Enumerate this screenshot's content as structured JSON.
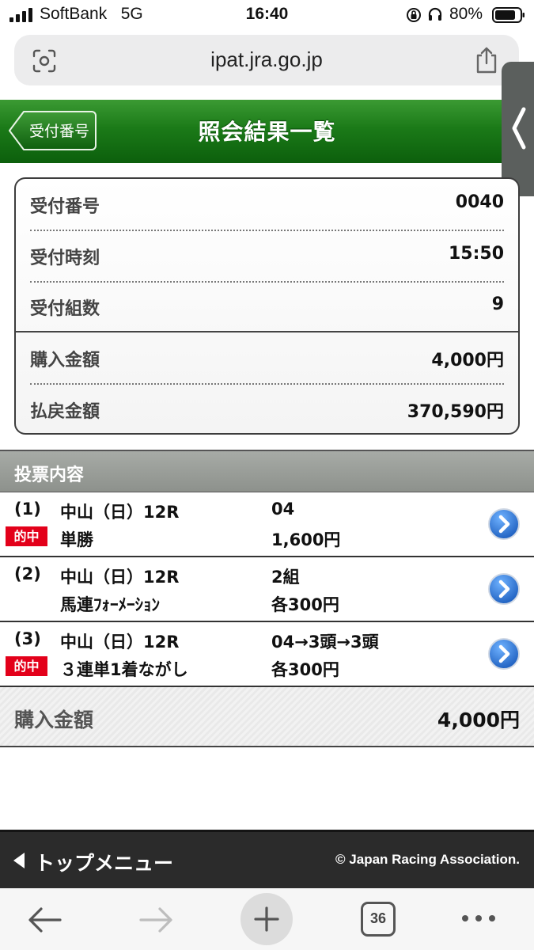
{
  "status_bar": {
    "carrier": "SoftBank",
    "network": "5G",
    "time": "16:40",
    "battery": "80%"
  },
  "browser": {
    "url": "ipat.jra.go.jp",
    "tab_count": "36"
  },
  "header": {
    "back_label": "受付番号",
    "title": "照会結果一覧"
  },
  "summary": [
    {
      "label": "受付番号",
      "value": "0040"
    },
    {
      "label": "受付時刻",
      "value": "15:50"
    },
    {
      "label": "受付組数",
      "value": "9"
    },
    {
      "label": "購入金額",
      "value": "4,000円"
    },
    {
      "label": "払戻金額",
      "value": "370,590円"
    }
  ],
  "section_title": "投票内容",
  "hit_label": "的中",
  "bets": [
    {
      "num": "(1)",
      "race": "中山（日）12R",
      "type": "単勝",
      "selection": "04",
      "amount": "1,600円",
      "hit": true
    },
    {
      "num": "(2)",
      "race": "中山（日）12R",
      "type": "馬連ﾌｫｰﾒｰｼｮﾝ",
      "selection": "2組",
      "amount": "各300円",
      "hit": false
    },
    {
      "num": "(3)",
      "race": "中山（日）12R",
      "type": "３連単1着ながし",
      "selection": "04→3頭→3頭",
      "amount": "各300円",
      "hit": true
    }
  ],
  "total": {
    "label": "購入金額",
    "value": "4,000円"
  },
  "footer": {
    "top_menu": "トップメニュー",
    "copyright": "© Japan Racing Association."
  },
  "colors": {
    "header_green": "#1b7a18",
    "hit_red": "#e3001a",
    "detail_blue": "#1f6fd1",
    "footer_dark": "#2b2b2b"
  },
  "icons": [
    "signal-icon",
    "orientation-lock-icon",
    "headphones-icon",
    "battery-icon",
    "camera-scan-icon",
    "share-icon",
    "chevron-left-icon",
    "detail-arrow-icon",
    "triangle-left-icon",
    "back-arrow-icon",
    "forward-arrow-icon",
    "plus-icon",
    "tabs-icon",
    "more-icon"
  ]
}
